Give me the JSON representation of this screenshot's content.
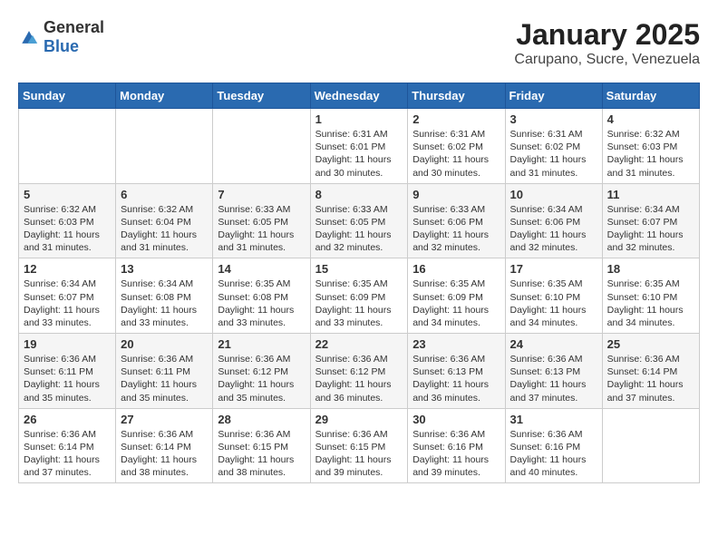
{
  "logo": {
    "general": "General",
    "blue": "Blue"
  },
  "title": "January 2025",
  "subtitle": "Carupano, Sucre, Venezuela",
  "weekdays": [
    "Sunday",
    "Monday",
    "Tuesday",
    "Wednesday",
    "Thursday",
    "Friday",
    "Saturday"
  ],
  "weeks": [
    [
      {
        "day": "",
        "info": ""
      },
      {
        "day": "",
        "info": ""
      },
      {
        "day": "",
        "info": ""
      },
      {
        "day": "1",
        "info": "Sunrise: 6:31 AM\nSunset: 6:01 PM\nDaylight: 11 hours\nand 30 minutes."
      },
      {
        "day": "2",
        "info": "Sunrise: 6:31 AM\nSunset: 6:02 PM\nDaylight: 11 hours\nand 30 minutes."
      },
      {
        "day": "3",
        "info": "Sunrise: 6:31 AM\nSunset: 6:02 PM\nDaylight: 11 hours\nand 31 minutes."
      },
      {
        "day": "4",
        "info": "Sunrise: 6:32 AM\nSunset: 6:03 PM\nDaylight: 11 hours\nand 31 minutes."
      }
    ],
    [
      {
        "day": "5",
        "info": "Sunrise: 6:32 AM\nSunset: 6:03 PM\nDaylight: 11 hours\nand 31 minutes."
      },
      {
        "day": "6",
        "info": "Sunrise: 6:32 AM\nSunset: 6:04 PM\nDaylight: 11 hours\nand 31 minutes."
      },
      {
        "day": "7",
        "info": "Sunrise: 6:33 AM\nSunset: 6:05 PM\nDaylight: 11 hours\nand 31 minutes."
      },
      {
        "day": "8",
        "info": "Sunrise: 6:33 AM\nSunset: 6:05 PM\nDaylight: 11 hours\nand 32 minutes."
      },
      {
        "day": "9",
        "info": "Sunrise: 6:33 AM\nSunset: 6:06 PM\nDaylight: 11 hours\nand 32 minutes."
      },
      {
        "day": "10",
        "info": "Sunrise: 6:34 AM\nSunset: 6:06 PM\nDaylight: 11 hours\nand 32 minutes."
      },
      {
        "day": "11",
        "info": "Sunrise: 6:34 AM\nSunset: 6:07 PM\nDaylight: 11 hours\nand 32 minutes."
      }
    ],
    [
      {
        "day": "12",
        "info": "Sunrise: 6:34 AM\nSunset: 6:07 PM\nDaylight: 11 hours\nand 33 minutes."
      },
      {
        "day": "13",
        "info": "Sunrise: 6:34 AM\nSunset: 6:08 PM\nDaylight: 11 hours\nand 33 minutes."
      },
      {
        "day": "14",
        "info": "Sunrise: 6:35 AM\nSunset: 6:08 PM\nDaylight: 11 hours\nand 33 minutes."
      },
      {
        "day": "15",
        "info": "Sunrise: 6:35 AM\nSunset: 6:09 PM\nDaylight: 11 hours\nand 33 minutes."
      },
      {
        "day": "16",
        "info": "Sunrise: 6:35 AM\nSunset: 6:09 PM\nDaylight: 11 hours\nand 34 minutes."
      },
      {
        "day": "17",
        "info": "Sunrise: 6:35 AM\nSunset: 6:10 PM\nDaylight: 11 hours\nand 34 minutes."
      },
      {
        "day": "18",
        "info": "Sunrise: 6:35 AM\nSunset: 6:10 PM\nDaylight: 11 hours\nand 34 minutes."
      }
    ],
    [
      {
        "day": "19",
        "info": "Sunrise: 6:36 AM\nSunset: 6:11 PM\nDaylight: 11 hours\nand 35 minutes."
      },
      {
        "day": "20",
        "info": "Sunrise: 6:36 AM\nSunset: 6:11 PM\nDaylight: 11 hours\nand 35 minutes."
      },
      {
        "day": "21",
        "info": "Sunrise: 6:36 AM\nSunset: 6:12 PM\nDaylight: 11 hours\nand 35 minutes."
      },
      {
        "day": "22",
        "info": "Sunrise: 6:36 AM\nSunset: 6:12 PM\nDaylight: 11 hours\nand 36 minutes."
      },
      {
        "day": "23",
        "info": "Sunrise: 6:36 AM\nSunset: 6:13 PM\nDaylight: 11 hours\nand 36 minutes."
      },
      {
        "day": "24",
        "info": "Sunrise: 6:36 AM\nSunset: 6:13 PM\nDaylight: 11 hours\nand 37 minutes."
      },
      {
        "day": "25",
        "info": "Sunrise: 6:36 AM\nSunset: 6:14 PM\nDaylight: 11 hours\nand 37 minutes."
      }
    ],
    [
      {
        "day": "26",
        "info": "Sunrise: 6:36 AM\nSunset: 6:14 PM\nDaylight: 11 hours\nand 37 minutes."
      },
      {
        "day": "27",
        "info": "Sunrise: 6:36 AM\nSunset: 6:14 PM\nDaylight: 11 hours\nand 38 minutes."
      },
      {
        "day": "28",
        "info": "Sunrise: 6:36 AM\nSunset: 6:15 PM\nDaylight: 11 hours\nand 38 minutes."
      },
      {
        "day": "29",
        "info": "Sunrise: 6:36 AM\nSunset: 6:15 PM\nDaylight: 11 hours\nand 39 minutes."
      },
      {
        "day": "30",
        "info": "Sunrise: 6:36 AM\nSunset: 6:16 PM\nDaylight: 11 hours\nand 39 minutes."
      },
      {
        "day": "31",
        "info": "Sunrise: 6:36 AM\nSunset: 6:16 PM\nDaylight: 11 hours\nand 40 minutes."
      },
      {
        "day": "",
        "info": ""
      }
    ]
  ]
}
